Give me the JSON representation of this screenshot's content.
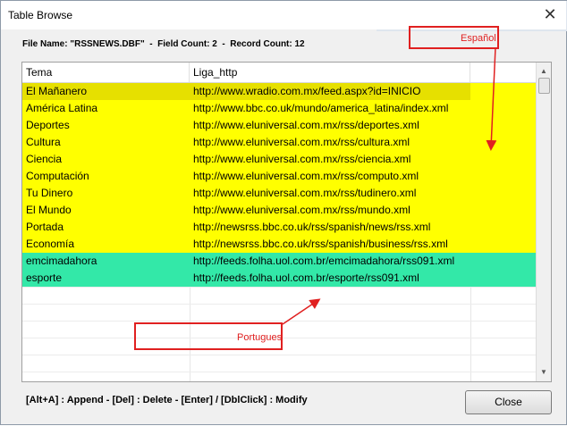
{
  "window": {
    "title": "Table Browse",
    "close_glyph": "✕"
  },
  "info": {
    "text": "File Name: \"RSSNEWS.DBF\"  -  Field Count: 2  -  Record Count: 12"
  },
  "table": {
    "columns": [
      "Tema",
      "Liga_http"
    ],
    "rows": [
      {
        "tema": "El Mañanero",
        "liga": "http://www.wradio.com.mx/feed.aspx?id=INICIO",
        "group": "es"
      },
      {
        "tema": "América Latina",
        "liga": "http://www.bbc.co.uk/mundo/america_latina/index.xml",
        "group": "es"
      },
      {
        "tema": "Deportes",
        "liga": "http://www.eluniversal.com.mx/rss/deportes.xml",
        "group": "es"
      },
      {
        "tema": "Cultura",
        "liga": "http://www.eluniversal.com.mx/rss/cultura.xml",
        "group": "es"
      },
      {
        "tema": "Ciencia",
        "liga": "http://www.eluniversal.com.mx/rss/ciencia.xml",
        "group": "es"
      },
      {
        "tema": "Computación",
        "liga": "http://www.eluniversal.com.mx/rss/computo.xml",
        "group": "es"
      },
      {
        "tema": "Tu Dinero",
        "liga": "http://www.eluniversal.com.mx/rss/tudinero.xml",
        "group": "es"
      },
      {
        "tema": "El Mundo",
        "liga": "http://www.eluniversal.com.mx/rss/mundo.xml",
        "group": "es"
      },
      {
        "tema": "Portada",
        "liga": "http://newsrss.bbc.co.uk/rss/spanish/news/rss.xml",
        "group": "es"
      },
      {
        "tema": "Economía",
        "liga": "http://newsrss.bbc.co.uk/rss/spanish/business/rss.xml",
        "group": "es"
      },
      {
        "tema": "emcimadahora",
        "liga": "http://feeds.folha.uol.com.br/emcimadahora/rss091.xml",
        "group": "pt"
      },
      {
        "tema": "esporte",
        "liga": "http://feeds.folha.uol.com.br/esporte/rss091.xml",
        "group": "pt"
      }
    ]
  },
  "colors": {
    "spanish_row": "#ffff00",
    "selected_row": "#e6e000",
    "portuguese_row": "#33e8a8",
    "annotation": "#e02020"
  },
  "footer": {
    "hint": "[Alt+A] : Append  -  [Del] : Delete  -  [Enter] / [DblClick] : Modify",
    "close_label": "Close"
  },
  "annotations": {
    "spanish_label": "Español",
    "portuguese_label": "Portugues"
  },
  "scrollbar": {
    "up_glyph": "▲",
    "down_glyph": "▼"
  }
}
